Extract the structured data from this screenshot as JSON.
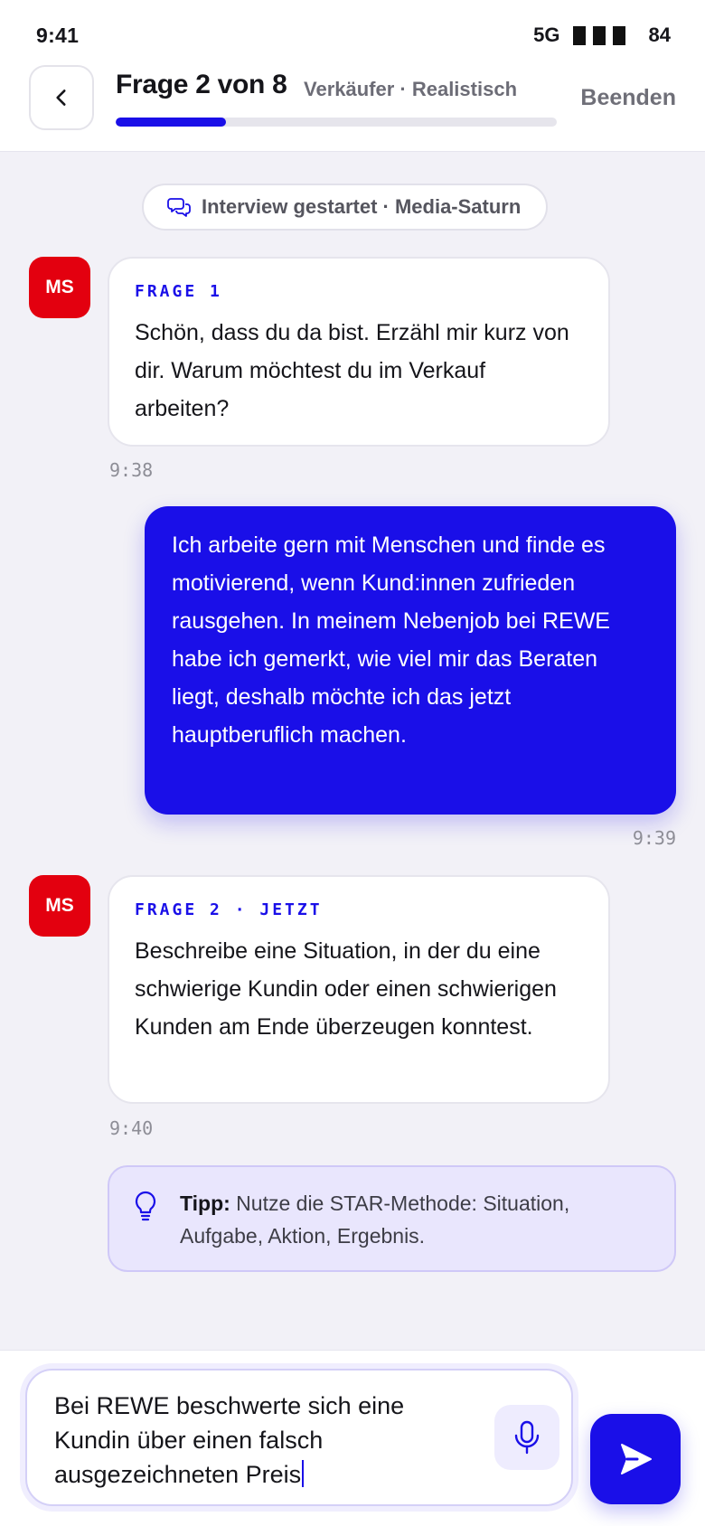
{
  "status": {
    "time": "9:41",
    "network": "5G",
    "battery": "84"
  },
  "header": {
    "title": "Frage 2 von 8",
    "subtitle": "Verkäufer · Realistisch",
    "end_label": "Beenden",
    "progress_fraction": 0.25
  },
  "chat": {
    "session_pill": "Interview gestartet · Media-Saturn",
    "avatar_initials": "MS",
    "messages": [
      {
        "label": "FRAGE 1",
        "text": "Schön, dass du da bist. Erzähl mir kurz von dir. Warum möchtest du im Verkauf arbeiten?",
        "time": "9:38"
      },
      {
        "text": "Ich arbeite gern mit Menschen und finde es motivierend, wenn Kund:innen zufrieden rausgehen. In meinem Nebenjob bei REWE habe ich gemerkt, wie viel mir das Beraten liegt, deshalb möchte ich das jetzt hauptberuflich machen.",
        "time": "9:39"
      },
      {
        "label": "FRAGE 2 · JETZT",
        "text": "Beschreibe eine Situation, in der du eine schwierige Kundin oder einen schwierigen Kunden am Ende überzeugen konntest.",
        "time": "9:40"
      }
    ],
    "tip": {
      "label": "Tipp:",
      "text": " Nutze die STAR-Methode: Situation, Aufgabe, Aktion, Ergebnis."
    }
  },
  "composer": {
    "value": "Bei REWE beschwerte sich eine Kundin über einen falsch ausgezeichneten Preis"
  },
  "colors": {
    "accent": "#1a0fe8",
    "brand": "#e3000f",
    "tip_bg": "#e9e6fd"
  },
  "icons": {
    "back": "chevron-left-icon",
    "pill": "chat-bubbles-icon",
    "tip": "lightbulb-icon",
    "mic": "microphone-icon",
    "send": "send-icon"
  }
}
